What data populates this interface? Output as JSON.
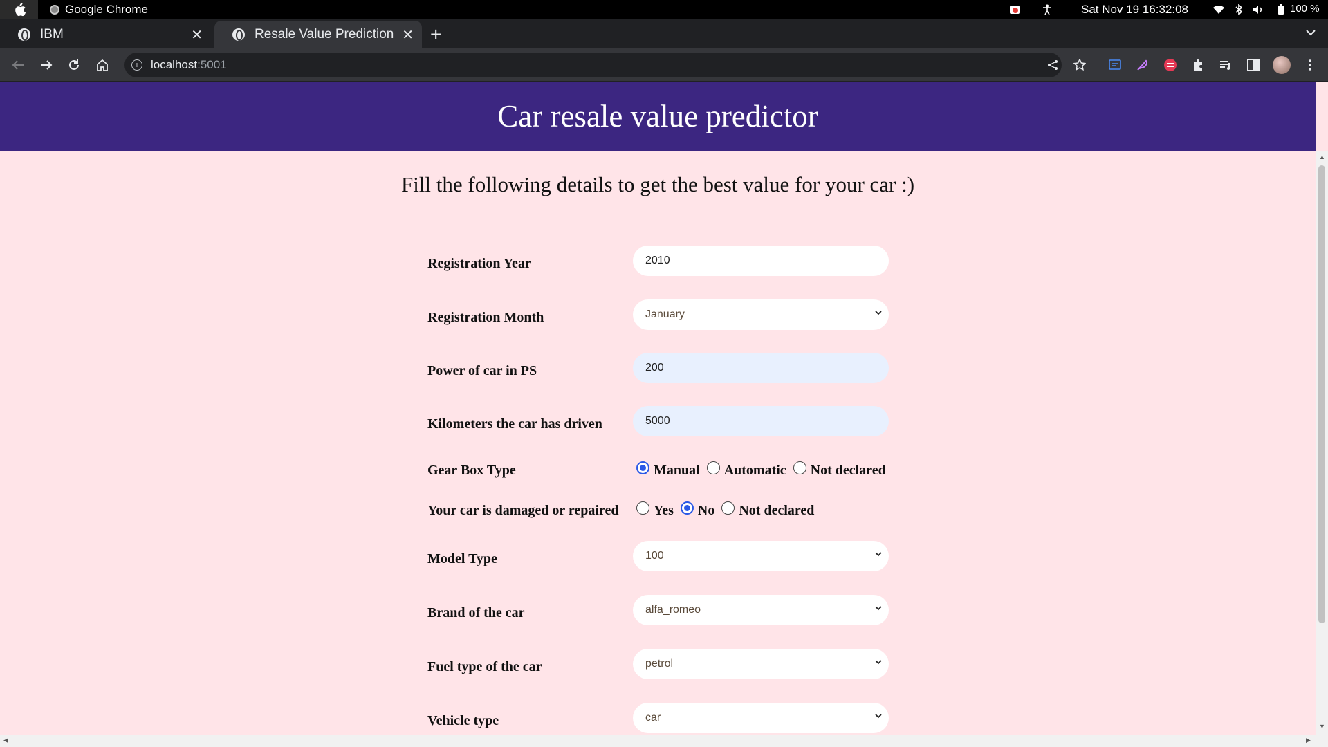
{
  "os": {
    "app_name": "Google Chrome",
    "datetime": "Sat Nov 19  16:32:08",
    "battery": "100 %"
  },
  "tabs": [
    {
      "title": "IBM",
      "active": false
    },
    {
      "title": "Resale Value Prediction",
      "active": true
    }
  ],
  "omnibox": {
    "host": "localhost",
    "port": ":5001"
  },
  "page": {
    "header": "Car resale value predictor",
    "subtitle": "Fill the following details to get the best value for your car :)",
    "fields": {
      "registration_year": {
        "label": "Registration Year",
        "value": "2010"
      },
      "registration_month": {
        "label": "Registration Month",
        "value": "January"
      },
      "power_ps": {
        "label": "Power of car in PS",
        "value": "200"
      },
      "kilometers": {
        "label": "Kilometers the car has driven",
        "value": "5000"
      },
      "gearbox": {
        "label": "Gear Box Type",
        "options": [
          "Manual",
          "Automatic",
          "Not declared"
        ],
        "selected": "Manual"
      },
      "damaged": {
        "label": "Your car is damaged or repaired",
        "options": [
          "Yes",
          "No",
          "Not declared"
        ],
        "selected": "No"
      },
      "model_type": {
        "label": "Model Type",
        "value": "100"
      },
      "brand": {
        "label": "Brand of the car",
        "value": "alfa_romeo"
      },
      "fuel_type": {
        "label": "Fuel type of the car",
        "value": "petrol"
      },
      "vehicle_type": {
        "label": "Vehicle type",
        "value": "car"
      }
    }
  },
  "colors": {
    "header_bg": "#3c2681",
    "page_bg": "#ffe4e8",
    "radio_accent": "#2b59e6"
  }
}
